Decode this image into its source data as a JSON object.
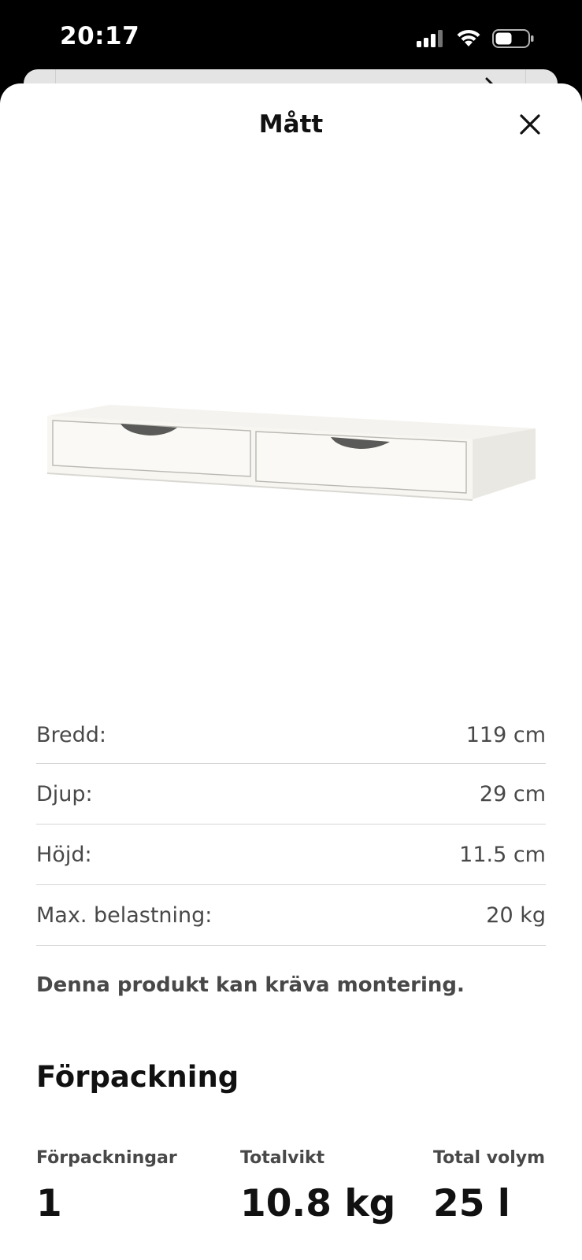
{
  "status_bar": {
    "time": "20:17",
    "icons": [
      "signal-icon",
      "wifi-icon",
      "battery-icon"
    ]
  },
  "sheet": {
    "title": "Mått",
    "close_icon": "close-icon"
  },
  "product_image": {
    "description_icon": "shelf-with-drawers-image"
  },
  "dimensions": [
    {
      "label": "Bredd:",
      "value": "119 cm"
    },
    {
      "label": "Djup:",
      "value": "29 cm"
    },
    {
      "label": "Höjd:",
      "value": "11.5 cm"
    },
    {
      "label": "Max. belastning:",
      "value": "20 kg"
    }
  ],
  "assembly_note": "Denna produkt kan kräva montering.",
  "packaging": {
    "heading": "Förpackning",
    "stats": [
      {
        "label": "Förpackningar",
        "value": "1"
      },
      {
        "label": "Totalvikt",
        "value": "10.8 kg"
      },
      {
        "label": "Total volym",
        "value": "25 l"
      }
    ]
  },
  "colors": {
    "background": "#ffffff",
    "text_primary": "#111111",
    "text_secondary": "#484848",
    "divider": "#d6d6d6"
  }
}
